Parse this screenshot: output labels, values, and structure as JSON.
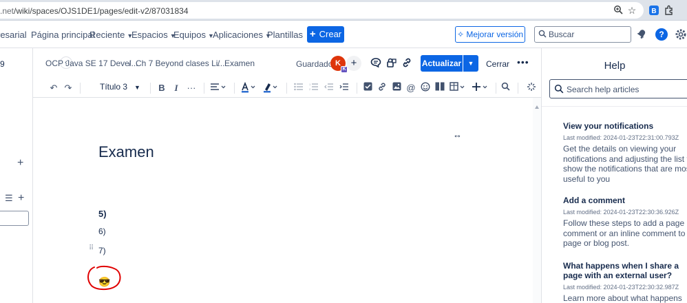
{
  "browser": {
    "url_prefix": "",
    "url_domain_tail": ".net",
    "url_path": "/wiki/spaces/OJS1DE1/pages/edit-v2/87031834"
  },
  "topnav": {
    "items": [
      {
        "label": "resarial",
        "dropdown": false
      },
      {
        "label": "Página principal",
        "dropdown": false
      },
      {
        "label": "Reciente",
        "dropdown": true
      },
      {
        "label": "Espacios",
        "dropdown": true
      },
      {
        "label": "Equipos",
        "dropdown": true
      },
      {
        "label": "Aplicaciones",
        "dropdown": true
      },
      {
        "label": "Plantillas",
        "dropdown": false
      }
    ],
    "create_label": "Crear",
    "upgrade_label": "Mejorar versión",
    "search_placeholder": "Buscar",
    "help_glyph": "?"
  },
  "sidebar": {
    "fragment": "9"
  },
  "editor_header": {
    "breadcrumbs": [
      "OCP Java SE 17 Devel...",
      "Ch 7 Beyond clases Li...",
      "Examen"
    ],
    "status": "Guardado",
    "avatar_initial": "K",
    "avatar_badge": "K",
    "update_label": "Actualizar",
    "close_label": "Cerrar"
  },
  "toolbar": {
    "heading_style": "Título 3"
  },
  "document": {
    "title": "Examen",
    "lines": [
      "5)",
      "6)",
      "7)"
    ],
    "emoji": "😎"
  },
  "help_panel": {
    "title": "Help",
    "search_placeholder": "Search help articles",
    "articles": [
      {
        "title": "View your notifications",
        "modified": "Last modified: 2024-01-23T22:31:00.793Z",
        "description": "Get the details on viewing your notifications and adjusting the list to show the notifications that are most useful to you"
      },
      {
        "title": "Add a comment",
        "modified": "Last modified: 2024-01-23T22:30:36.926Z",
        "description": "Follow these steps to add a page comment or an inline comment to a page or blog post."
      },
      {
        "title": "What happens when I share a page with an external user?",
        "modified": "Last modified: 2024-01-23T22:30:32.987Z",
        "description": "Learn more about what happens when"
      }
    ]
  },
  "colors": {
    "brand_blue": "#0c66e4",
    "avatar_red": "#de350b",
    "annotation_red": "#e00000",
    "text_dark": "#172b4d"
  }
}
